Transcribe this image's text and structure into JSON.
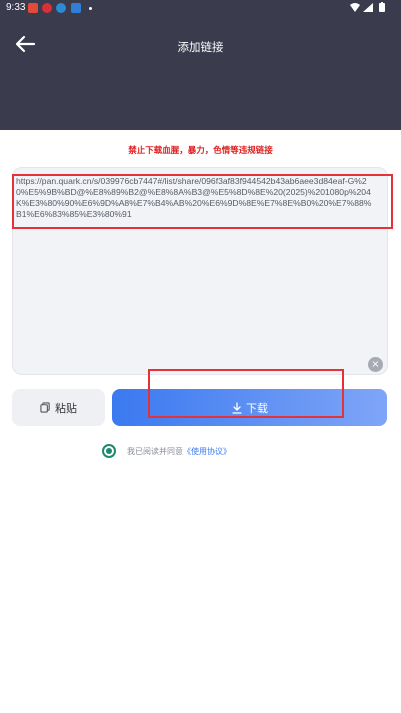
{
  "status_bar": {
    "time": "9:33",
    "icons": [
      "app-red-icon",
      "app-red-2-icon",
      "app-blue-icon",
      "app-blue-2-icon",
      "dot-icon"
    ],
    "right_icons": [
      "wifi-icon",
      "signal-icon",
      "battery-icon"
    ]
  },
  "header": {
    "title": "添加链接"
  },
  "warning_text": "禁止下载血腥，暴力，色情等违规链接",
  "link_input": {
    "value": "https://pan.quark.cn/s/039976cb7447#/list/share/096f3af83f944542b43ab6aee3d84eaf-G%20%E5%9B%BD@%E8%89%B2@%E8%8A%B3@%E5%8D%8E%20(2025)%201080p%204K%E3%80%90%E6%9D%A8%E7%B4%AB%20%E6%9D%8E%E7%8E%B0%20%E7%88%B1%E6%83%85%E3%80%91"
  },
  "buttons": {
    "paste_label": "粘贴",
    "download_label": "下载"
  },
  "agreement": {
    "checked": true,
    "text": "我已阅读并同意",
    "link": "《使用协议》"
  },
  "colors": {
    "header_bg": "#3a3b4d",
    "warning": "#e02020",
    "download_gradient_start": "#3a79f0",
    "download_gradient_end": "#7fa5f7",
    "radio": "#1c8a6e",
    "annotation_box": "#e5323a"
  }
}
